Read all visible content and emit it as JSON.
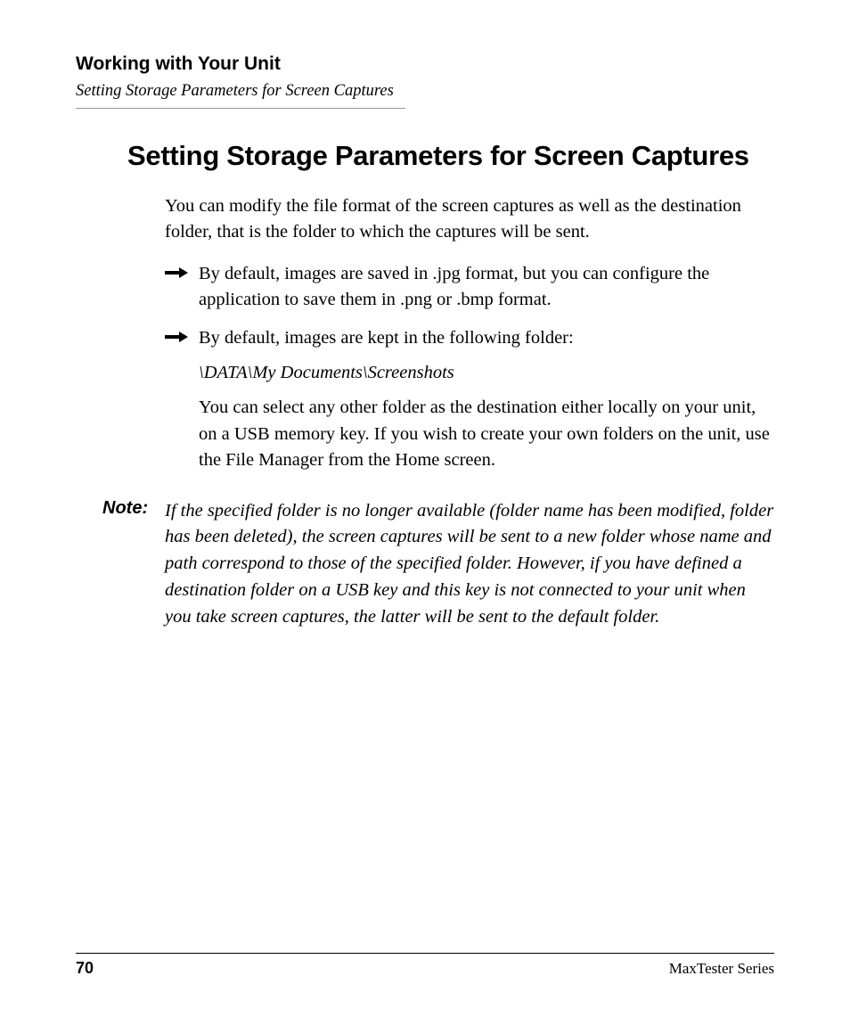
{
  "header": {
    "chapter": "Working with Your Unit",
    "section": "Setting Storage Parameters for Screen Captures"
  },
  "heading": "Setting Storage Parameters for Screen Captures",
  "intro": "You can modify the file format of the screen captures as well as the destination folder, that is the folder to which the captures will be sent.",
  "bullets": [
    {
      "text": "By default, images are saved in .jpg format, but you can configure the application to save them in .png or .bmp format."
    },
    {
      "text": "By default, images are kept in the following folder:",
      "path": "\\DATA\\My Documents\\Screenshots",
      "after": "You can select any other folder as the destination either locally on your unit, on a USB memory key. If you wish to create your own folders on the unit, use the File Manager from the Home screen."
    }
  ],
  "note": {
    "label": "Note:",
    "text": "If the specified folder is no longer available (folder name has been modified, folder has been deleted), the screen captures will be sent to a new folder whose name and path correspond to those of the specified folder. However, if you have defined a destination folder on a USB key and this key is not connected to your unit when you take screen captures, the latter will be sent to the default folder."
  },
  "footer": {
    "page": "70",
    "series": "MaxTester Series"
  }
}
